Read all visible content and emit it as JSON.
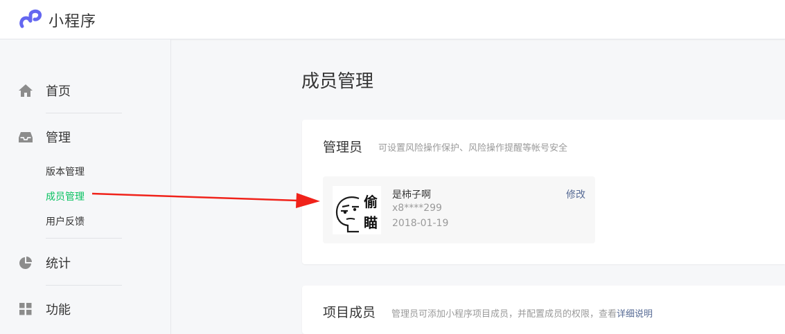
{
  "header": {
    "app_name": "小程序",
    "logo_icon": "mini-program-logo-icon",
    "accent_color": "#6467f0"
  },
  "sidebar": {
    "items": [
      {
        "label": "首页",
        "icon": "home-icon"
      },
      {
        "label": "管理",
        "icon": "inbox-icon",
        "sub_items": [
          {
            "label": "版本管理",
            "active": false
          },
          {
            "label": "成员管理",
            "active": true
          },
          {
            "label": "用户反馈",
            "active": false
          }
        ]
      },
      {
        "label": "统计",
        "icon": "pie-chart-icon"
      },
      {
        "label": "功能",
        "icon": "grid-icon"
      }
    ],
    "active_color": "#07c160"
  },
  "main": {
    "title": "成员管理",
    "admin_card": {
      "title": "管理员",
      "desc": "可设置风险操作保护、风险操作提醒等帐号安全",
      "member": {
        "avatar_text_1": "偷",
        "avatar_text_2": "瞄",
        "name": "是柿子啊",
        "id": "x8****299",
        "date": "2018-01-19",
        "edit_label": "修改"
      }
    },
    "project_card": {
      "title": "项目成员",
      "desc": "管理员可添加小程序项目成员，并配置成员的权限，查看",
      "link": "详细说明"
    }
  },
  "annotation": {
    "arrow_color": "#f0221a"
  }
}
